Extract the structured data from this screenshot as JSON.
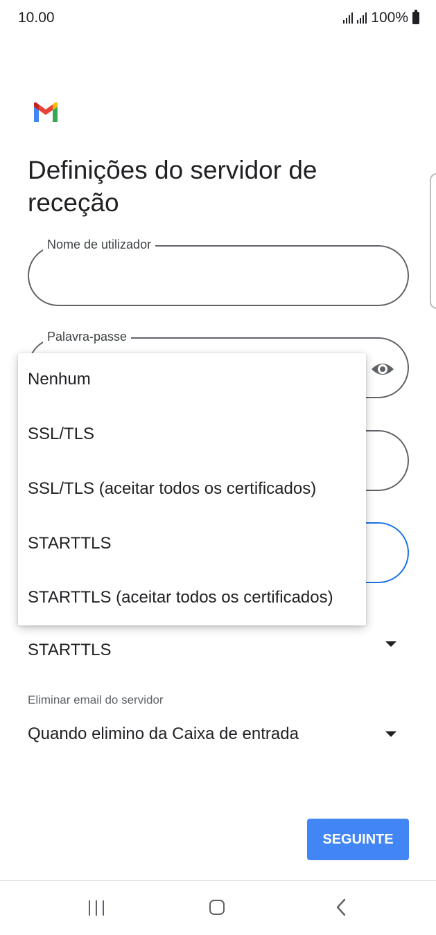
{
  "status_bar": {
    "time": "10.00",
    "battery": "100%",
    "icons": [
      "signal-icon",
      "signal-icon",
      "battery-icon"
    ]
  },
  "app": {
    "logo": "gmail-logo"
  },
  "page": {
    "title": "Definições do servidor de receção"
  },
  "form": {
    "username_label": "Nome de utilizador",
    "username_value": "",
    "password_label": "Palavra-passe",
    "password_value": ""
  },
  "security_dropdown": {
    "options": [
      "Nenhum",
      "SSL/TLS",
      "SSL/TLS (aceitar todos os certificados)",
      "STARTTLS",
      "STARTTLS (aceitar todos os certificados)"
    ],
    "selected": "STARTTLS"
  },
  "delete_setting": {
    "label": "Eliminar email do servidor",
    "value": "Quando elimino da Caixa de entrada"
  },
  "actions": {
    "next_label": "SEGUINTE"
  },
  "colors": {
    "primary_button": "#4285f4",
    "focus_outline": "#1a73e8",
    "text": "#202124"
  }
}
